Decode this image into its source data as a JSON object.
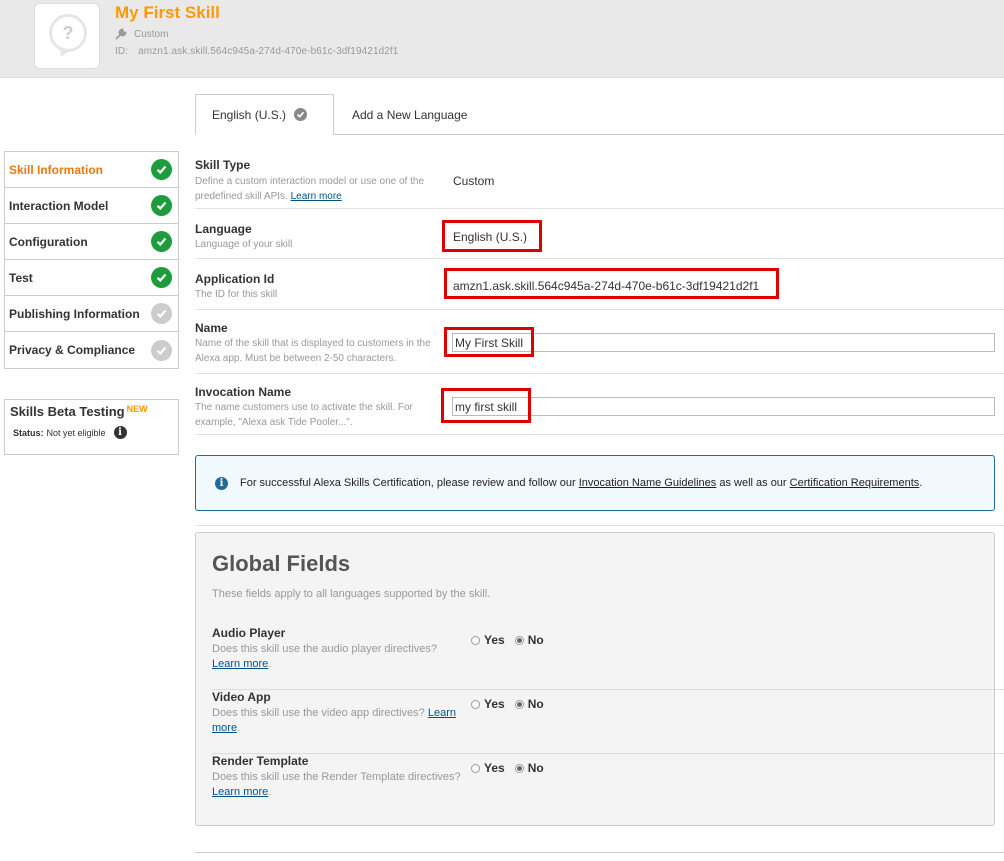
{
  "header": {
    "title": "My First Skill",
    "type": "Custom",
    "id_label": "ID:",
    "id_value": "amzn1.ask.skill.564c945a-274d-470e-b61c-3df19421d2f1",
    "icon": "question-bubble-icon"
  },
  "tabs": {
    "active": "English (U.S.)",
    "add": "Add a New Language"
  },
  "sidebar": {
    "items": [
      {
        "label": "Skill Information",
        "status": "complete"
      },
      {
        "label": "Interaction Model",
        "status": "complete"
      },
      {
        "label": "Configuration",
        "status": "complete"
      },
      {
        "label": "Test",
        "status": "complete"
      },
      {
        "label": "Publishing Information",
        "status": "incomplete"
      },
      {
        "label": "Privacy & Compliance",
        "status": "incomplete"
      }
    ],
    "beta": {
      "title": "Skills Beta Testing",
      "badge": "NEW",
      "status_label": "Status:",
      "status_value": "Not yet eligible"
    }
  },
  "form": {
    "skill_type": {
      "label": "Skill Type",
      "desc": "Define a custom interaction model or use one of the predefined skill APIs.",
      "link": "Learn more",
      "value": "Custom"
    },
    "language": {
      "label": "Language",
      "desc": "Language of your skill",
      "value": "English (U.S.)"
    },
    "application_id": {
      "label": "Application Id",
      "desc": "The ID for this skill",
      "value": "amzn1.ask.skill.564c945a-274d-470e-b61c-3df19421d2f1"
    },
    "name": {
      "label": "Name",
      "desc": "Name of the skill that is displayed to customers in the Alexa app. Must be between 2-50 characters.",
      "value": "My First Skill"
    },
    "invocation": {
      "label": "Invocation Name",
      "desc": "The name customers use to activate the skill. For example, \"Alexa ask Tide Pooler...\".",
      "value": "my first skill"
    }
  },
  "banner": {
    "text_1": "For successful Alexa Skills Certification, please review and follow our ",
    "link_1": "Invocation Name Guidelines",
    "text_2": " as well as our ",
    "link_2": "Certification Requirements",
    "text_3": "."
  },
  "global": {
    "title": "Global Fields",
    "subtitle": "These fields apply to all languages supported by the skill.",
    "yes_label": "Yes",
    "no_label": "No",
    "rows": [
      {
        "label": "Audio Player",
        "desc": "Does this skill use the audio player directives?",
        "link": "Learn more",
        "value": "No"
      },
      {
        "label": "Video App",
        "desc": "Does this skill use the video app directives?",
        "link": "Learn more",
        "value": "No"
      },
      {
        "label": "Render Template",
        "desc": "Does this skill use the Render Template directives?",
        "link": "Learn more",
        "value": "No"
      }
    ]
  },
  "colors": {
    "accent": "#ff9900",
    "complete": "#1e9c3c",
    "incomplete": "#cccccc",
    "highlight": "#e00000",
    "info": "#1f6c9c"
  }
}
